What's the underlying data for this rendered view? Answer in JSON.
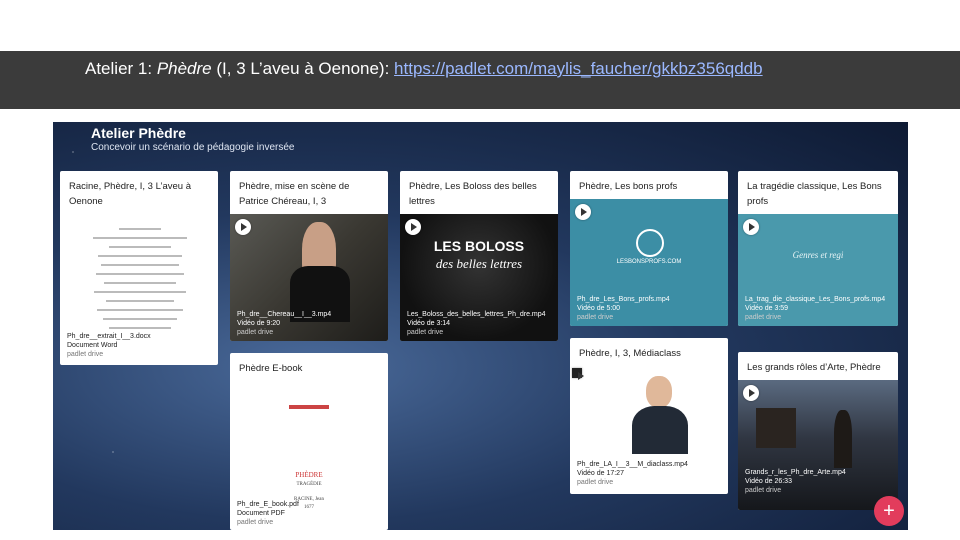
{
  "slide": {
    "heading_prefix": "Atelier 1: ",
    "heading_italic": "Phèdre",
    "heading_rest": " (I, 3 L’aveu à Oenone): ",
    "heading_link": "https://padlet.com/maylis_faucher/gkkbz356qddb"
  },
  "padlet": {
    "title": "Atelier Phèdre",
    "subtitle": "Concevoir un scénario de pédagogie inversée",
    "add_button": "+",
    "cards": [
      {
        "title": "Racine, Phèdre, I, 3 L’aveu à Oenone",
        "file": "Ph_dre__extrait_I__3.docx",
        "meta": "Document Word",
        "source": "padlet drive"
      },
      {
        "title": "Phèdre, mise en scène de Patrice Chéreau, I, 3",
        "file": "Ph_dre__Chereau__I__3.mp4",
        "meta": "Vidéo de 9:20",
        "source": "padlet drive"
      },
      {
        "title": "Phèdre, Les Boloss des belles lettres",
        "file": "Les_Boloss_des_belles_lettres_Ph_dre.mp4",
        "meta": "Vidéo de 3:14",
        "source": "padlet drive",
        "thumb_line1": "LES BOLOSS",
        "thumb_line2": "des belles lettres"
      },
      {
        "title": "Phèdre, Les bons profs",
        "file": "Ph_dre_Les_Bons_profs.mp4",
        "meta": "Vidéo de 5:00",
        "source": "padlet drive",
        "thumb_text": "LESBONSPROFS.COM"
      },
      {
        "title": "La tragédie classique, Les Bons profs",
        "file": "La_trag_die_classique_Les_Bons_profs.mp4",
        "meta": "Vidéo de 3:59",
        "source": "padlet drive",
        "thumb_text": "Genres et regi"
      },
      {
        "title": "Phèdre E-book",
        "file": "Ph_dre_E_book.pdf",
        "meta": "Document PDF",
        "source": "padlet drive",
        "book_title": "PHÈDRE",
        "book_sub": "TRAGÉDIE",
        "book_author": "RACINE, Jean",
        "book_year": "1677"
      },
      {
        "title": "Phèdre, I, 3, Médiaclass",
        "file": "Ph_dre_LA_I__3__M_diaclass.mp4",
        "meta": "Vidéo de 17:27",
        "source": "padlet drive"
      },
      {
        "title": "Les grands rôles d’Arte, Phèdre",
        "file": "Grands_r_les_Ph_dre_Arte.mp4",
        "meta": "Vidéo de 26:33",
        "source": "padlet drive"
      }
    ]
  }
}
